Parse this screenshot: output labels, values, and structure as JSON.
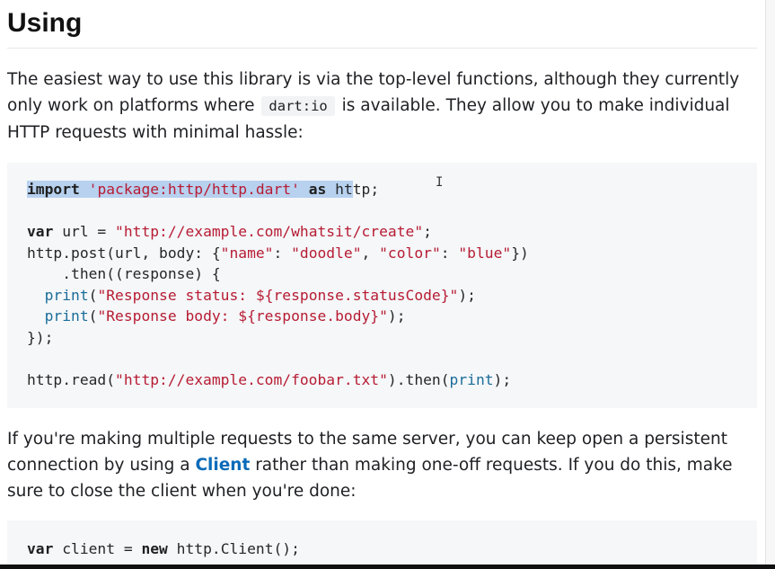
{
  "heading": "Using",
  "intro": {
    "before": "The easiest way to use this library is via the top-level functions, although they currently only work on platforms where",
    "code": "dart:io",
    "after": "is available. They allow you to make individual HTTP requests with minimal hassle:"
  },
  "code_block_1": {
    "l1_kw_import": "import",
    "l1_str": "'package:http/http.dart'",
    "l1_kw_as": "as",
    "l1_sel_tail": "ht",
    "l1_rest": "tp;",
    "l2_kw": "var",
    "l2_mid": " url = ",
    "l2_str": "\"http://example.com/whatsit/create\"",
    "l2_end": ";",
    "l3_a": "http.post(url, body: {",
    "l3_s1": "\"name\"",
    "l3_b": ": ",
    "l3_s2": "\"doodle\"",
    "l3_c": ", ",
    "l3_s3": "\"color\"",
    "l3_d": ": ",
    "l3_s4": "\"blue\"",
    "l3_e": "})",
    "l4": "    .then((response) {",
    "l5_fn": "print",
    "l5_a": "(",
    "l5_str": "\"Response status: ${response.statusCode}\"",
    "l5_b": ");",
    "l6_fn": "print",
    "l6_a": "(",
    "l6_str": "\"Response body: ${response.body}\"",
    "l6_b": ");",
    "l7": "});",
    "l8_a": "http.read(",
    "l8_str": "\"http://example.com/foobar.txt\"",
    "l8_b": ").then(",
    "l8_fn": "print",
    "l8_c": ");"
  },
  "para2": {
    "before": "If you're making multiple requests to the same server, you can keep open a persistent connection by using a",
    "link": "Client",
    "after": "rather than making one-off requests. If you do this, make sure to close the client when you're done:"
  },
  "code_block_2": {
    "l1_kw_var": "var",
    "l1_mid": " client = ",
    "l1_kw_new": "new",
    "l1_rest": " http.Client();"
  },
  "cursor_glyph": "I"
}
